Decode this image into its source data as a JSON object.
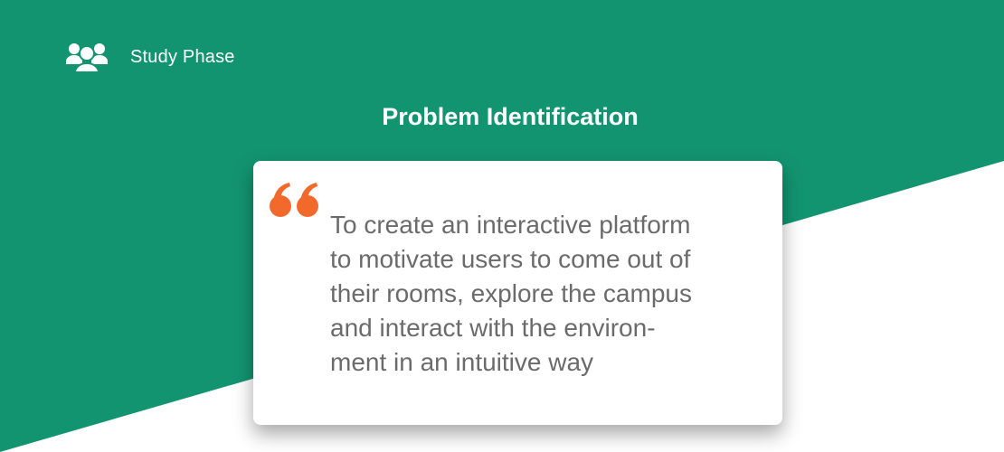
{
  "header": {
    "icon": "users-group-icon",
    "label": "Study Phase"
  },
  "title": "Problem Identification",
  "quote": {
    "icon": "quote-mark-icon",
    "text": "To create an interactive platform\nto motivate users to come out of\ntheir rooms, explore the campus\nand interact with the environ-\nment in an intuitive way"
  },
  "colors": {
    "background_green": "#139470",
    "background_white": "#ffffff",
    "quote_accent": "#f26a2b",
    "quote_text": "#6b6b6b"
  }
}
